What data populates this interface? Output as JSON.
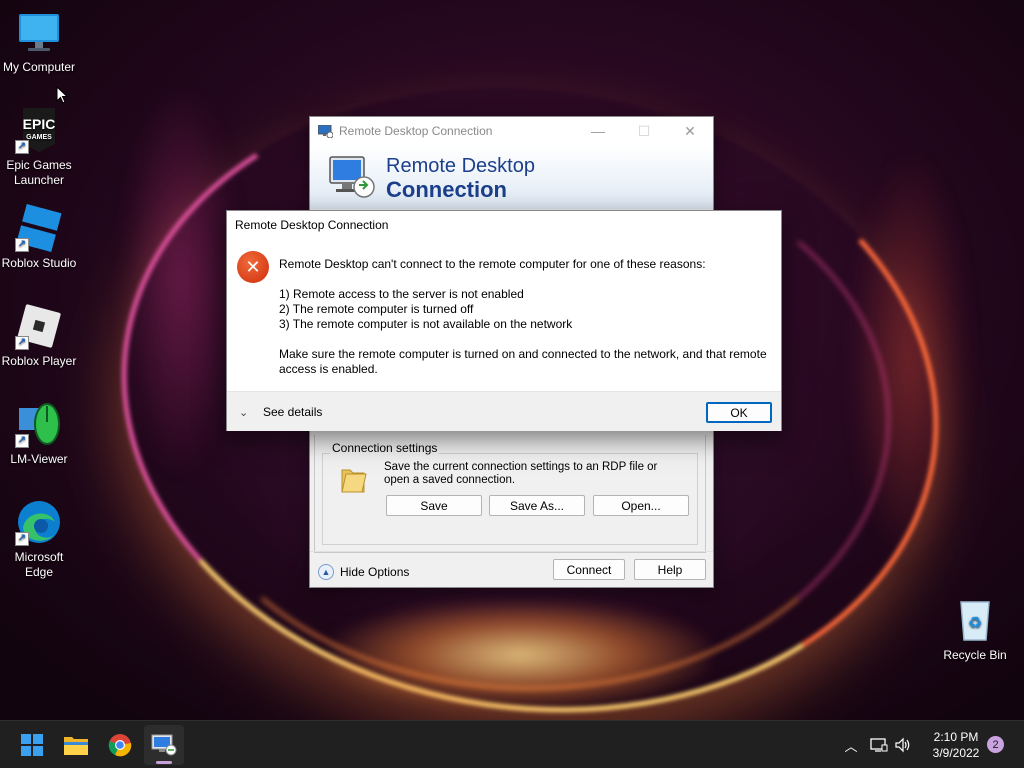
{
  "desktop": {
    "icons": [
      {
        "label": "My Computer"
      },
      {
        "label": "Epic Games Launcher",
        "logo_text": "EPIC",
        "logo_sub": "GAMES"
      },
      {
        "label": "Roblox Studio"
      },
      {
        "label": "Roblox Player"
      },
      {
        "label": "LM-Viewer"
      },
      {
        "label": "Microsoft Edge"
      },
      {
        "label": "Recycle Bin"
      }
    ]
  },
  "rdp_window": {
    "title": "Remote Desktop Connection",
    "banner_line1": "Remote Desktop",
    "banner_line2": "Connection",
    "connection_settings": {
      "legend": "Connection settings",
      "description": "Save the current connection settings to an RDP file or open a saved connection.",
      "save_label": "Save",
      "save_as_label": "Save As...",
      "open_label": "Open..."
    },
    "hide_options_label": "Hide Options",
    "connect_label": "Connect",
    "help_label": "Help"
  },
  "error_dialog": {
    "title": "Remote Desktop Connection",
    "intro": "Remote Desktop can't connect to the remote computer for one of these reasons:",
    "reasons": [
      "1) Remote access to the server is not enabled",
      "2) The remote computer is turned off",
      "3) The remote computer is not available on the network"
    ],
    "advice": "Make sure the remote computer is turned on and connected to the network, and that remote access is enabled.",
    "see_details_label": "See details",
    "ok_label": "OK",
    "icon": "error-icon"
  },
  "taskbar": {
    "apps": [
      "start-icon",
      "file-explorer-icon",
      "chrome-icon",
      "remote-desktop-icon"
    ],
    "time": "2:10 PM",
    "date": "3/9/2022",
    "notification_count": "2"
  },
  "colors": {
    "accent": "#0067c0",
    "error_red": "#d9401a",
    "rdp_blue": "#1b3f8b",
    "taskbar": "#202020"
  }
}
